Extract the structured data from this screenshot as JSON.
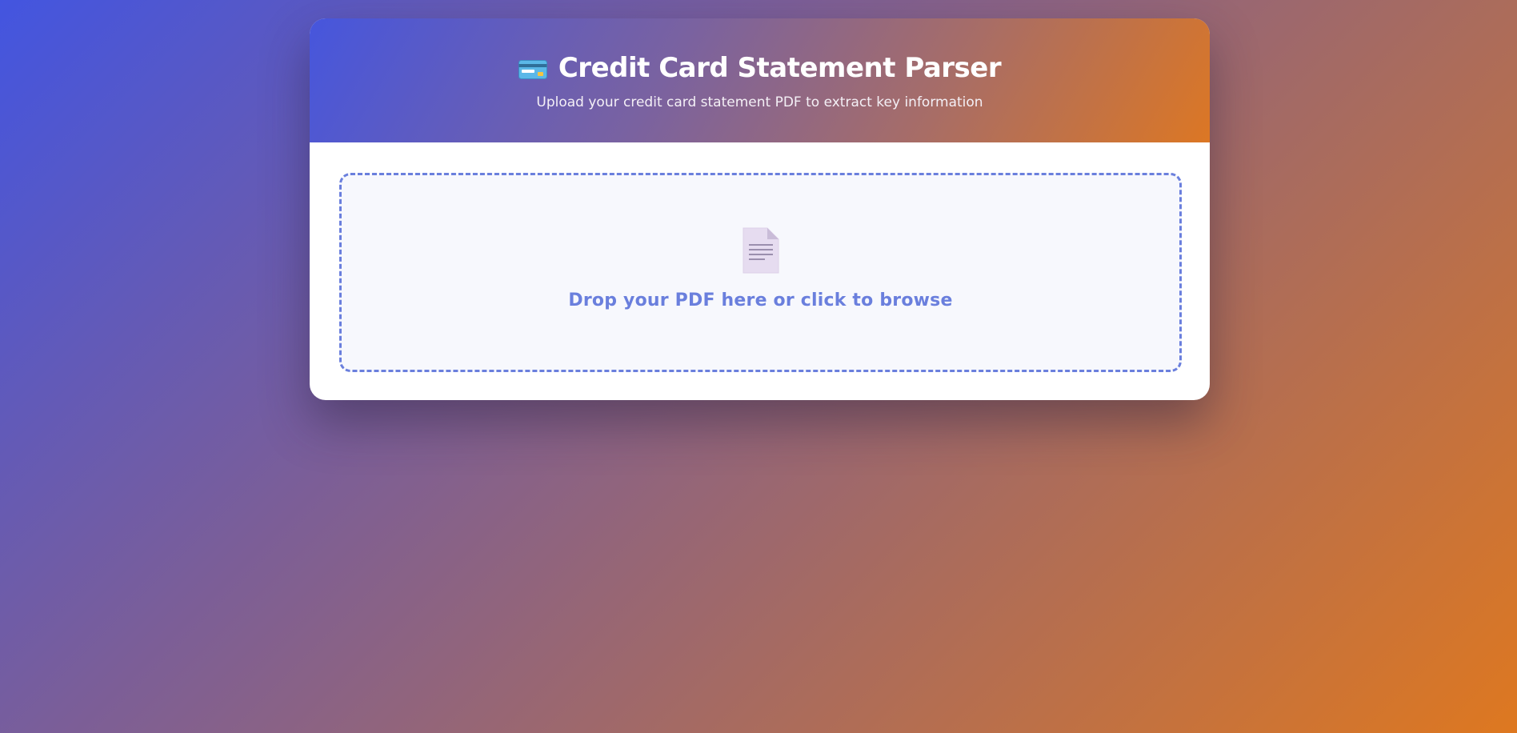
{
  "header": {
    "icon": "credit-card-icon",
    "title": "Credit Card Statement Parser",
    "subtitle": "Upload your credit card statement PDF to extract key information"
  },
  "upload": {
    "icon": "document-icon",
    "prompt": "Drop your PDF here or click to browse"
  },
  "colors": {
    "accent": "#6a7fdd",
    "gradient_start": "#4355e0",
    "gradient_end": "#de7820",
    "dropzone_bg": "#f7f8fd"
  }
}
